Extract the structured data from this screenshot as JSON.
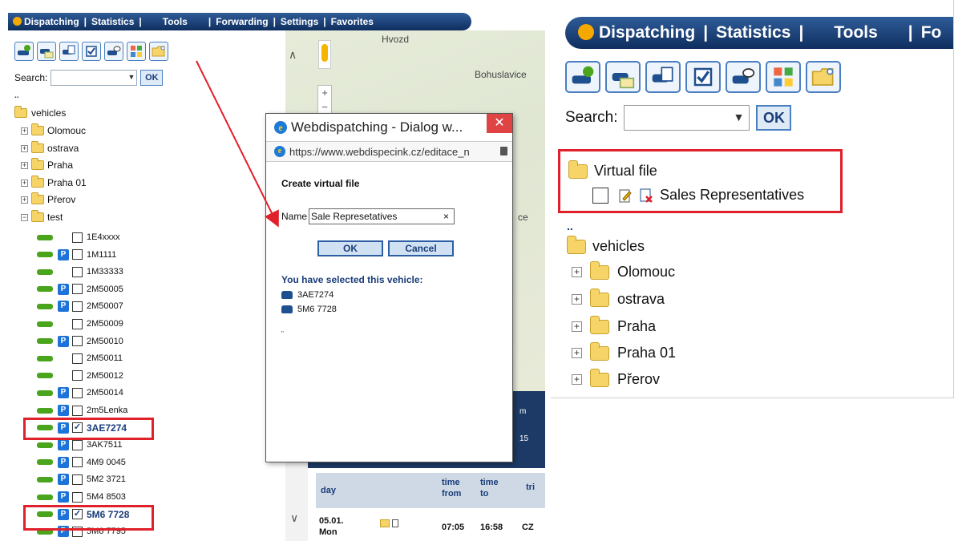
{
  "nav": {
    "dispatching": "Dispatching",
    "statistics": "Statistics",
    "tools": "Tools",
    "forwarding": "Forwarding",
    "settings": "Settings",
    "favorites": "Favorites",
    "sep": "|"
  },
  "search": {
    "label": "Search:",
    "ok": "OK"
  },
  "tree": {
    "dotdot": "..",
    "root": "vehicles",
    "groups": [
      "Olomouc",
      "ostrava",
      "Praha",
      "Praha 01",
      "Přerov",
      "test"
    ],
    "vehicles": [
      {
        "plate": "1E4xxxx",
        "parked": false,
        "checked": false
      },
      {
        "plate": "1M1111",
        "parked": true,
        "checked": false
      },
      {
        "plate": "1M33333",
        "parked": false,
        "checked": false
      },
      {
        "plate": "2M50005",
        "parked": true,
        "checked": false
      },
      {
        "plate": "2M50007",
        "parked": true,
        "checked": false
      },
      {
        "plate": "2M50009",
        "parked": false,
        "checked": false
      },
      {
        "plate": "2M50010",
        "parked": true,
        "checked": false
      },
      {
        "plate": "2M50011",
        "parked": false,
        "checked": false
      },
      {
        "plate": "2M50012",
        "parked": false,
        "checked": false
      },
      {
        "plate": "2M50014",
        "parked": true,
        "checked": false
      },
      {
        "plate": "2m5Lenka",
        "parked": true,
        "checked": false
      },
      {
        "plate": "3AE7274",
        "parked": true,
        "checked": true
      },
      {
        "plate": "3AK7511",
        "parked": true,
        "checked": false
      },
      {
        "plate": "4M9 0045",
        "parked": true,
        "checked": false
      },
      {
        "plate": "5M2 3721",
        "parked": true,
        "checked": false
      },
      {
        "plate": "5M4 8503",
        "parked": true,
        "checked": false
      },
      {
        "plate": "5M6 7728",
        "parked": true,
        "checked": true
      },
      {
        "plate": "5M6 7795",
        "parked": true,
        "checked": false
      }
    ]
  },
  "map": {
    "label1": "Hvozd",
    "label2": "Bohuslavice",
    "frag": "ce"
  },
  "dialog": {
    "title": "Webdispatching - Dialog w...",
    "url": "https://www.webdispecink.cz/editace_n",
    "heading": "Create virtual file",
    "name_label": "Name",
    "name_value": "Sale Represetatives",
    "clear": "×",
    "ok": "OK",
    "cancel": "Cancel",
    "selected_title": "You have selected this vehicle:",
    "selected": [
      "3AE7274",
      "5M6 7728"
    ],
    "tiny": "\""
  },
  "trip": {
    "cols": {
      "day": "day",
      "time": "time",
      "from": "from",
      "to": "to",
      "tri": "tri"
    },
    "row": {
      "day": "05.01.",
      "day2": "Mon",
      "from": "07:05",
      "to": "16:58",
      "cz": "CZ"
    },
    "mini1": "m",
    "mini2": "15"
  },
  "zoom": {
    "virtual_file": "Virtual file",
    "sales": "Sales Representatives",
    "fo": "Fo",
    "groups": [
      "Olomouc",
      "ostrava",
      "Praha",
      "Praha 01",
      "Přerov"
    ]
  },
  "colors": {
    "accent": "#1a3d7a",
    "highlight": "#e0202a",
    "nav": "#0f2e5f",
    "park": "#1e73d8",
    "vehicle": "#4aa51d"
  }
}
